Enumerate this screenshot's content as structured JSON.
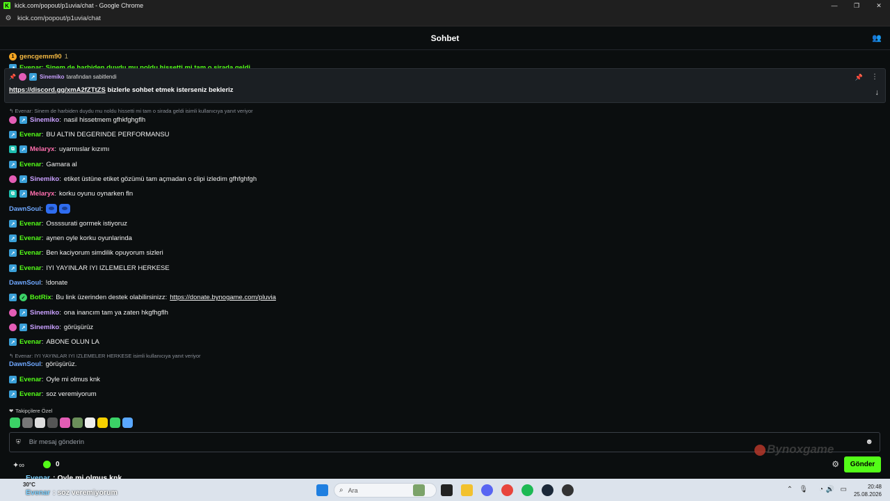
{
  "browser": {
    "window_title": "kick.com/popout/p1uvia/chat - Google Chrome",
    "url": "kick.com/popout/p1uvia/chat",
    "favicon_letter": "K"
  },
  "header": {
    "title": "Sohbet"
  },
  "top_partial": {
    "user": "gencgemm90",
    "count": "1",
    "cut_text": "Evenar: Sinem de harbiden duydu mu noldu hissetti mi tam o sirada geldi"
  },
  "pinned": {
    "pinned_by": "Sinemiko",
    "pinned_suffix": "tarafından sabitlendi",
    "link": "https://discord.gg/xmA2fZTtZS",
    "text": "bizlerle sohbet etmek isterseniz bekleriz"
  },
  "reply1": "Evenar: Sinem de harbiden duydu mu noldu hissetti mi tam o sirada geldi isimli kullanıcıya yanıt veriyor",
  "messages": [
    {
      "user": "Sinemiko",
      "text": "nasil hissetmem gfhkfghgflh"
    },
    {
      "user": "Evenar",
      "text": "BU ALTIN DEGERINDE PERFORMANSU"
    },
    {
      "user": "Melaryx",
      "text": "uyarmıslar kızımı"
    },
    {
      "user": "Evenar",
      "text": "Gamara al"
    },
    {
      "user": "Sinemiko",
      "text": "etiket üstüne etiket gözümü tam açmadan o clipi izledim gfhfghfgh"
    },
    {
      "user": "Melaryx",
      "text": "korku oyunu oynarken fln"
    },
    {
      "user": "DawnSoul",
      "text": ""
    },
    {
      "user": "Evenar",
      "text": "Ossssurati gormek istiyoruz"
    },
    {
      "user": "Evenar",
      "text": "aynen oyle korku oyunlarinda"
    },
    {
      "user": "Evenar",
      "text": "Ben kaciyorum simdilik opuyorum sizleri"
    },
    {
      "user": "Evenar",
      "text": "IYI YAYINLAR IYI IZLEMELER HERKESE"
    },
    {
      "user": "DawnSoul",
      "text": "!donate"
    },
    {
      "user": "BotRix",
      "text": "Bu link üzerinden destek olabilirsinizz:",
      "link": "https://donate.bynogame.com/pluvia"
    },
    {
      "user": "Sinemiko",
      "text": "ona inancım tam ya zaten hkgfhgflh"
    },
    {
      "user": "Sinemiko",
      "text": "görüşürüz"
    },
    {
      "user": "Evenar",
      "text": "ABONE OLUN LA"
    }
  ],
  "reply2": "Evenar: IYI YAYINLAR IYI IZLEMELER HERKESE isimli kullanıcıya yanıt veriyor",
  "messages2": [
    {
      "user": "DawnSoul",
      "text": "görüşürüz."
    },
    {
      "user": "Evenar",
      "text": "Oyle mi olmus knk"
    },
    {
      "user": "Evenar",
      "text": "soz veremiyorum"
    }
  ],
  "follower_label": "Takipçilere Özel",
  "input": {
    "placeholder": "Bir mesaj gönderin"
  },
  "kicks_count": "0",
  "send_label": "Gönder",
  "overlay": [
    {
      "user": "Evenar",
      "text": ": Oyle mi olmus knk"
    },
    {
      "user": "Evenar",
      "text": ": soz veremiyorum"
    }
  ],
  "weather": {
    "temp": "30°C"
  },
  "search": {
    "placeholder": "Ara"
  },
  "clock": {
    "time": "20:48",
    "date": "25.08.2026"
  },
  "colors": {
    "Evenar": "#53fc18",
    "Sinemiko": "#c9a0ff",
    "Melaryx": "#ff6fae",
    "DawnSoul": "#6fa8ff",
    "BotRix": "#53fc18",
    "gencgemm90": "#f5b942",
    "accent": "#53fc18"
  }
}
